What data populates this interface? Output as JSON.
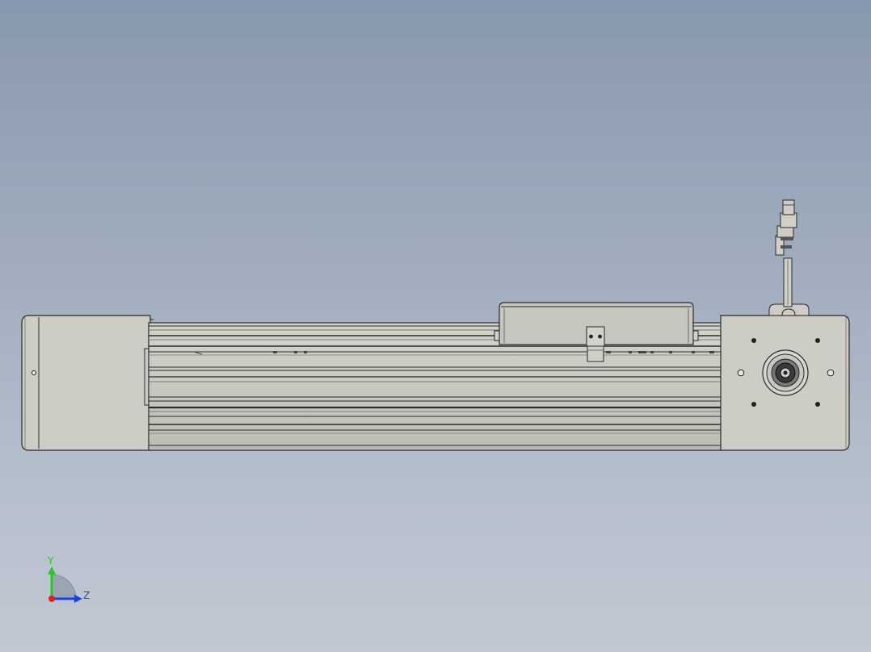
{
  "viewport": {
    "background_top": "#8898ad",
    "background_bottom": "#c0c8d3",
    "model": {
      "name": "linear-actuator-module",
      "view": "front",
      "body_color": "#c9c9c1",
      "outline_color": "#2a2a2a"
    }
  },
  "triad": {
    "y_label": "Y",
    "z_label": "Z",
    "y_color": "#22cc22",
    "z_color": "#1f3ee0",
    "x_color": "#e02020"
  }
}
